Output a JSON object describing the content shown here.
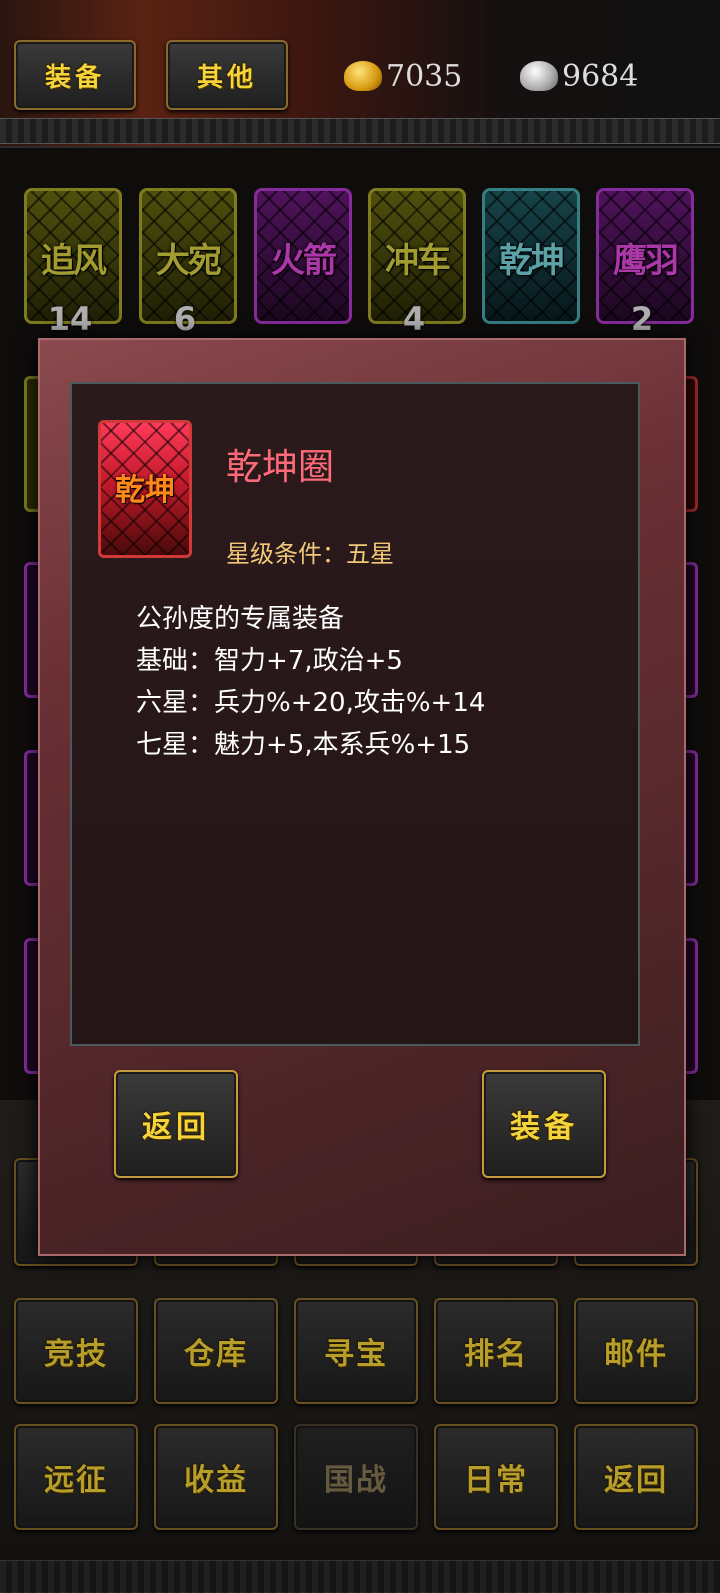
{
  "header": {
    "tab_equip": "装备",
    "tab_other": "其他",
    "gold_value": "7035",
    "silver_value": "9684"
  },
  "cards": [
    {
      "name": "追风",
      "count": "14",
      "color": "yellow"
    },
    {
      "name": "大宛",
      "count": "6",
      "color": "yellow"
    },
    {
      "name": "火箭",
      "count": "",
      "color": "purple"
    },
    {
      "name": "冲车",
      "count": "4",
      "color": "yellow"
    },
    {
      "name": "乾坤",
      "count": "",
      "color": "cyan"
    },
    {
      "name": "鹰羽",
      "count": "2",
      "color": "purple"
    }
  ],
  "bottom_menu": {
    "row2": [
      "竞技",
      "仓库",
      "寻宝",
      "排名",
      "邮件"
    ],
    "row3": [
      "远征",
      "收益",
      "国战",
      "日常",
      "返回"
    ]
  },
  "dialog": {
    "icon_label": "乾坤",
    "item_name": "乾坤圈",
    "star_requirement": "星级条件：五星",
    "description_lines": [
      "公孙度的专属装备",
      "基础：智力+7,政治+5",
      "六星：兵力%+20,攻击%+14",
      "七星：魅力+5,本系兵%+15"
    ],
    "back_button": "返回",
    "equip_button": "装备"
  },
  "colors": {
    "gold_text": "#f5d33a",
    "item_title": "#ff6a7a",
    "star_text": "#f0c878"
  }
}
